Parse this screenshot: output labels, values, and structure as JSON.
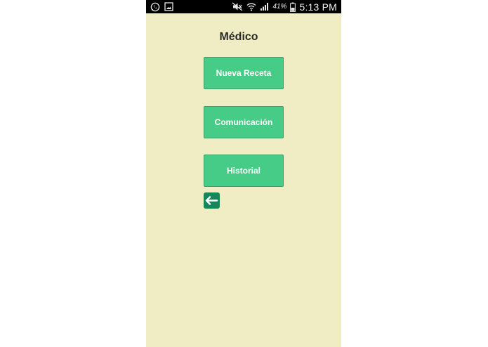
{
  "status_bar": {
    "left_icons": [
      "whatsapp-icon",
      "gallery-icon"
    ],
    "right_icons": [
      "mute-icon",
      "wifi-icon",
      "signal-icon",
      "battery-icon"
    ],
    "battery_percent": "41%",
    "time": "5:13 PM",
    "background": "#000000"
  },
  "screen": {
    "title": "Médico",
    "background": "#f0ecc4"
  },
  "buttons": [
    {
      "label": "Nueva Receta"
    },
    {
      "label": "Comunicación"
    },
    {
      "label": "Historial"
    }
  ],
  "back_button": {
    "icon": "back-arrow-icon",
    "color": "#16875a"
  },
  "colors": {
    "button": "#46cc86",
    "button_text": "#ffffff",
    "title_text": "#2a2a2a"
  }
}
